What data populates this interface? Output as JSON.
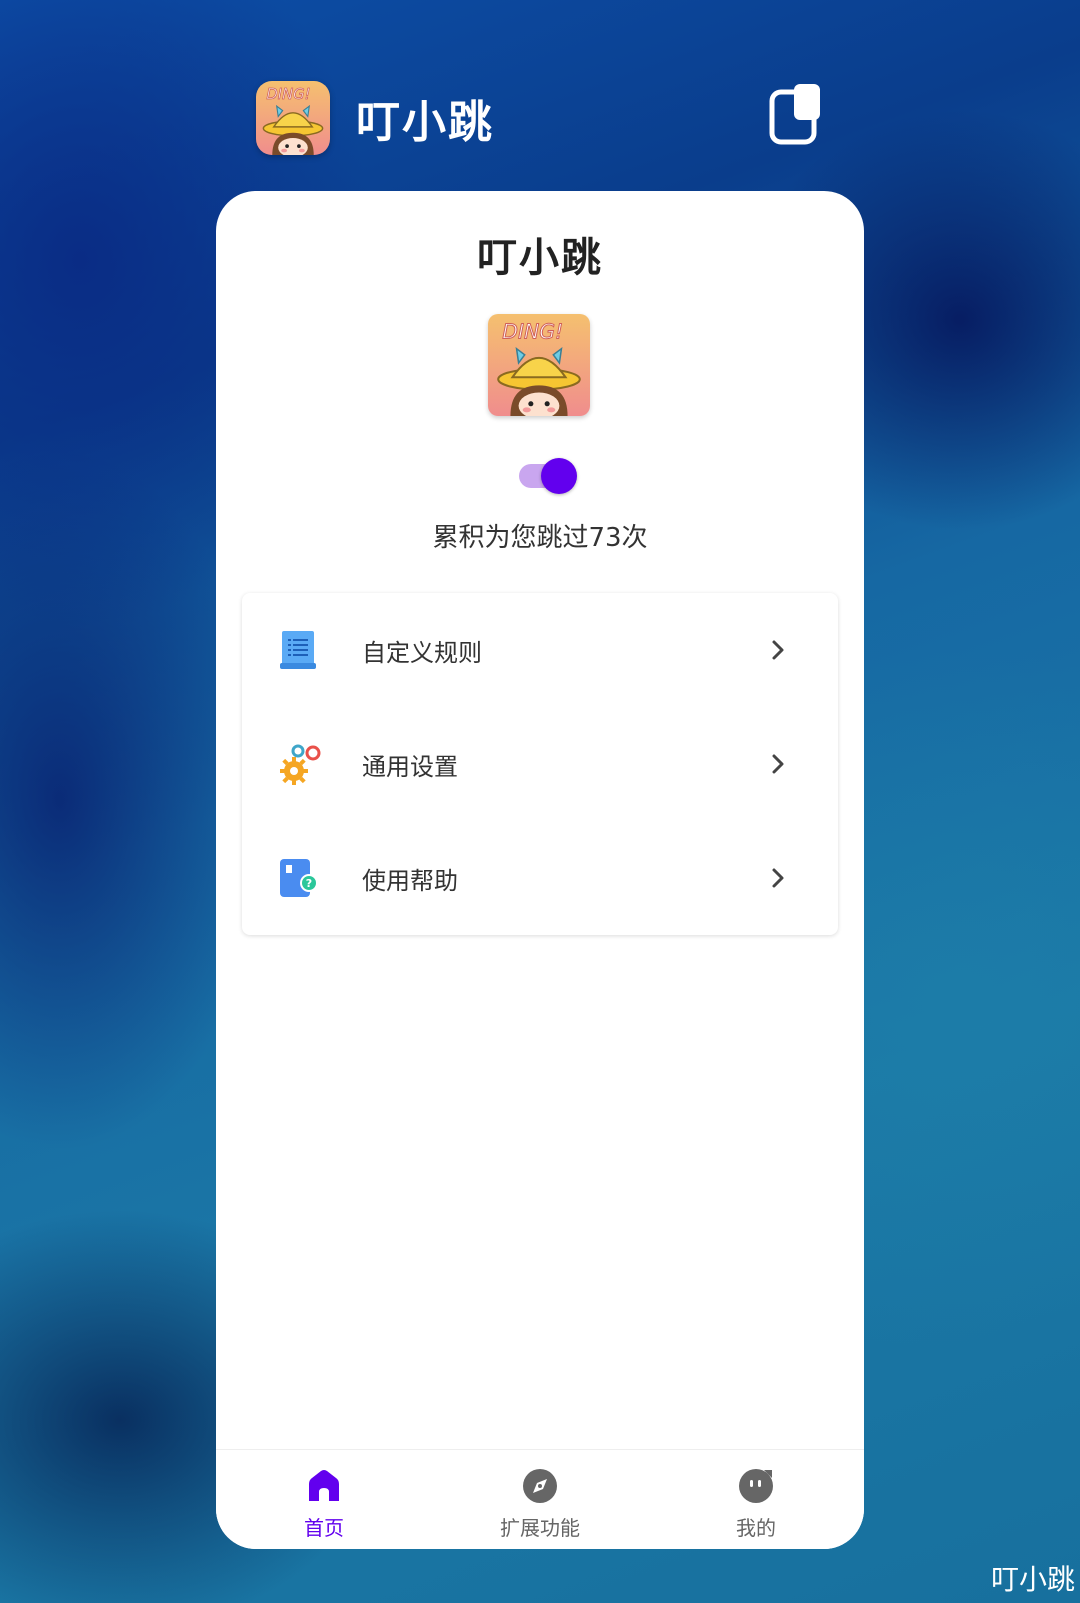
{
  "task_header": {
    "title": "叮小跳"
  },
  "app": {
    "title": "叮小跳",
    "logo_text": "DING!",
    "service_enabled": true,
    "stats_text": "累积为您跳过73次"
  },
  "menu": {
    "items": [
      {
        "label": "自定义规则",
        "icon": "document-list-icon"
      },
      {
        "label": "通用设置",
        "icon": "gears-icon"
      },
      {
        "label": "使用帮助",
        "icon": "help-book-icon"
      }
    ]
  },
  "bottom_nav": {
    "items": [
      {
        "label": "首页",
        "icon": "home-icon",
        "active": true
      },
      {
        "label": "扩展功能",
        "icon": "compass-icon",
        "active": false
      },
      {
        "label": "我的",
        "icon": "profile-face-icon",
        "active": false
      }
    ]
  },
  "caption": "叮小跳",
  "colors": {
    "accent": "#6200ee",
    "toggle_track": "#c9a6ef"
  }
}
